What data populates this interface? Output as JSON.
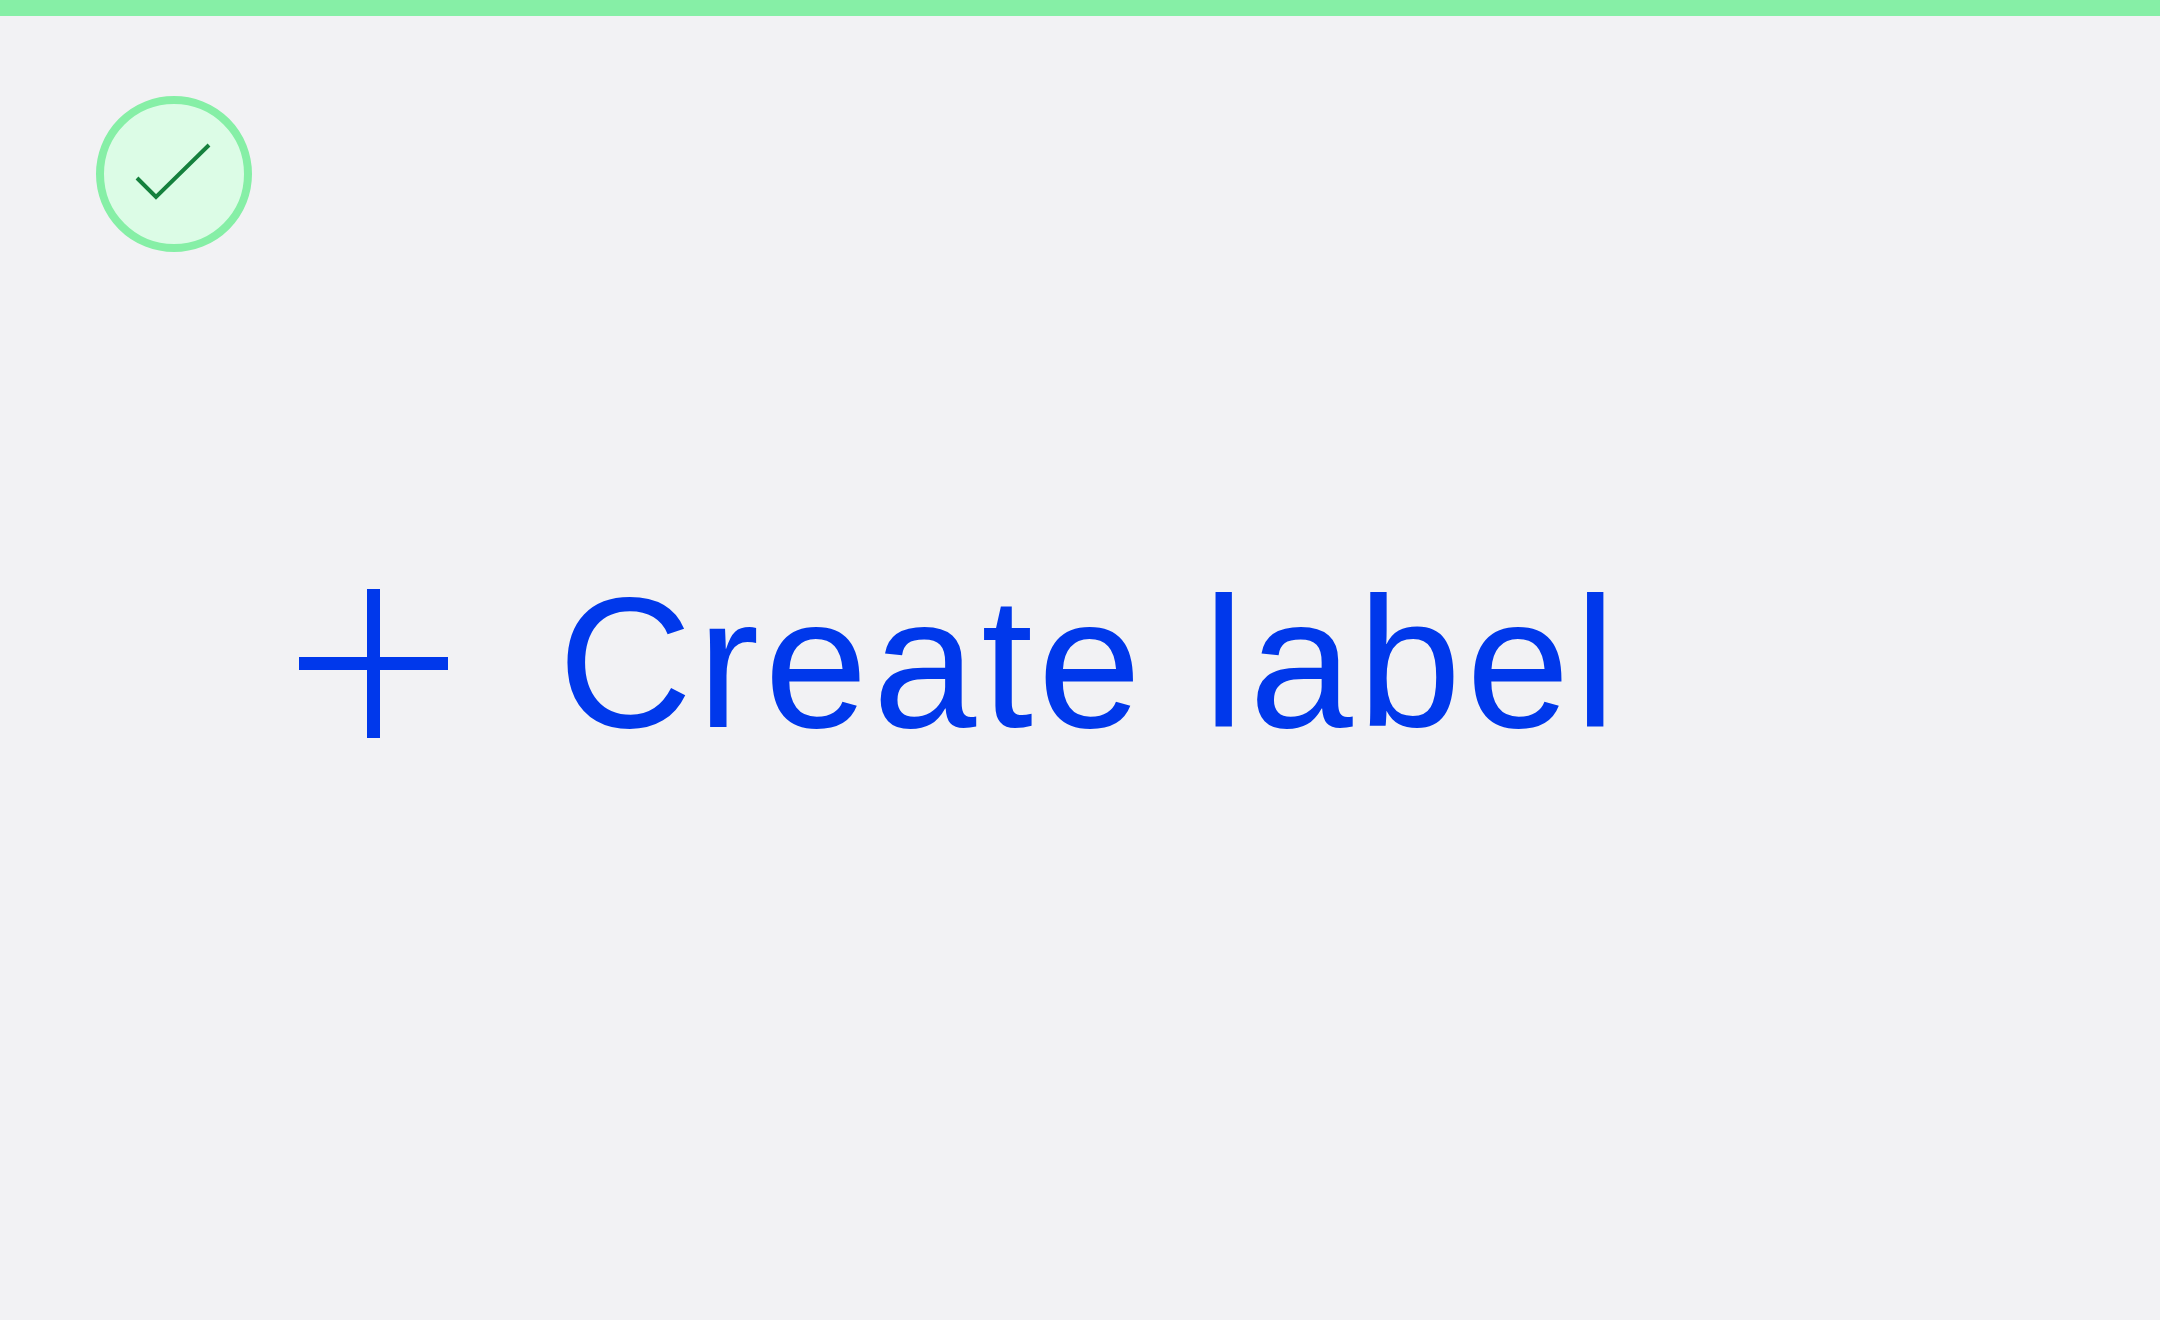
{
  "status": {
    "kind": "success"
  },
  "create_button": {
    "label": "Create label"
  }
}
